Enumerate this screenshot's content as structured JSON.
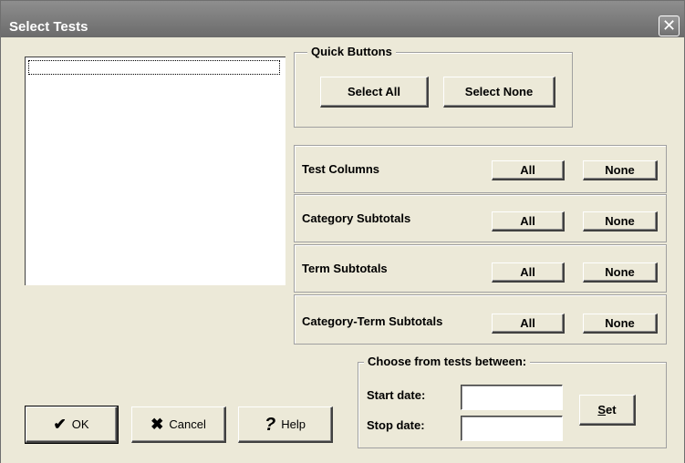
{
  "window": {
    "title": "Select Tests",
    "close_glyph": "✕"
  },
  "quick_buttons": {
    "legend": "Quick Buttons",
    "select_all": "Select All",
    "select_none": "Select None"
  },
  "rows": [
    {
      "label": "Test Columns",
      "all": "All",
      "none": "None"
    },
    {
      "label": "Category Subtotals",
      "all": "All",
      "none": "None"
    },
    {
      "label": "Term Subtotals",
      "all": "All",
      "none": "None"
    },
    {
      "label": "Category-Term Subtotals",
      "all": "All",
      "none": "None"
    }
  ],
  "date_range": {
    "legend": "Choose from tests between:",
    "start_label": "Start date:",
    "stop_label": "Stop date:",
    "start_value": "",
    "stop_value": "",
    "set_button": "Set"
  },
  "footer": {
    "ok": "OK",
    "cancel": "Cancel",
    "help": "Help",
    "ok_icon": "checkmark-icon",
    "cancel_icon": "x-icon",
    "help_icon": "question-icon"
  }
}
